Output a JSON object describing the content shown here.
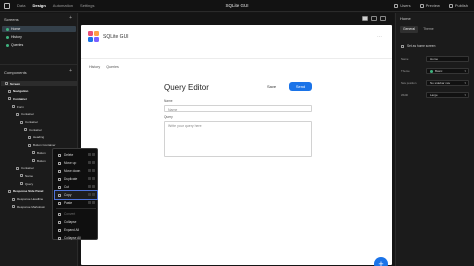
{
  "topbar": {
    "nav": [
      "Data",
      "Design",
      "Automation",
      "Settings"
    ],
    "active_nav": "Design",
    "title": "SQLite GUI",
    "users": "Users",
    "preview": "Preview",
    "publish": "Publish"
  },
  "left": {
    "screens_label": "Screens",
    "screens": [
      "Home",
      "History",
      "Queries"
    ],
    "components_label": "Components",
    "tree": [
      {
        "label": "Screen",
        "indent": 0,
        "bold": true
      },
      {
        "label": "Navigation",
        "indent": 1,
        "bold": true
      },
      {
        "label": "Container",
        "indent": 1,
        "bold": true
      },
      {
        "label": "Form",
        "indent": 2,
        "bold": false
      },
      {
        "label": "Container",
        "indent": 3,
        "bold": false
      },
      {
        "label": "Container",
        "indent": 4,
        "bold": false
      },
      {
        "label": "Container",
        "indent": 5,
        "bold": false
      },
      {
        "label": "Heading",
        "indent": 6,
        "bold": false
      },
      {
        "label": "Button Container",
        "indent": 6,
        "bold": false
      },
      {
        "label": "Button",
        "indent": 7,
        "bold": false
      },
      {
        "label": "Button",
        "indent": 7,
        "bold": false
      },
      {
        "label": "Container",
        "indent": 3,
        "bold": false
      },
      {
        "label": "Name",
        "indent": 4,
        "bold": false
      },
      {
        "label": "Query",
        "indent": 4,
        "bold": false
      },
      {
        "label": "Response Side Panel",
        "indent": 1,
        "bold": true
      },
      {
        "label": "Response Headline",
        "indent": 2,
        "bold": false
      },
      {
        "label": "Response Markdown",
        "indent": 2,
        "bold": false
      }
    ]
  },
  "context_menu": {
    "groups": [
      [
        "Delete",
        "Move up",
        "Move down",
        "Duplicate",
        "Cut",
        "Copy",
        "Paste"
      ],
      [
        "Convert",
        "Collapse",
        "Expand All",
        "Collapse All"
      ]
    ],
    "highlighted": "Copy",
    "disabled": [
      "Convert"
    ]
  },
  "page": {
    "brand": "SQLite GUI",
    "tabs": [
      "History",
      "Queries"
    ],
    "title": "Query Editor",
    "save_label": "Save",
    "send_label": "Send",
    "name_label": "Name",
    "name_placeholder": "Name",
    "query_label": "Query",
    "query_placeholder": "Write your query here",
    "fab": "+",
    "logo_colors": [
      "#e94e77",
      "#ff9f43",
      "#1a73e8",
      "#7b61ff"
    ]
  },
  "right": {
    "screen_name": "Home",
    "tabs": [
      "General",
      "Theme"
    ],
    "active_tab": "General",
    "home_checkbox": "Set as home screen",
    "props": [
      {
        "label": "Name",
        "value": "Home"
      },
      {
        "label": "Theme",
        "value": "Basic"
      },
      {
        "label": "Nav position",
        "value": "No sidebar nav"
      },
      {
        "label": "Width",
        "value": "Large"
      }
    ]
  },
  "colors": {
    "accent": "#1a73e8",
    "green": "#3fb37f",
    "highlight": "#4e73d9"
  }
}
